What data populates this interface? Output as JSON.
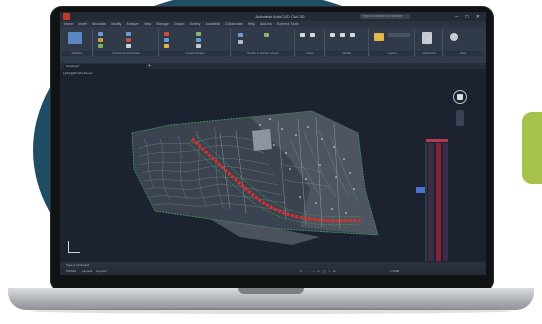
{
  "window": {
    "title": "Autodesk AutoCAD Civil 3D",
    "search_placeholder": "Type a keyword or phrase",
    "controls": "–  □  ✕"
  },
  "menu": {
    "items": [
      "Home",
      "Insert",
      "Annotate",
      "Modify",
      "Analyze",
      "View",
      "Manage",
      "Output",
      "Survey",
      "Autodesk",
      "Collaborate",
      "Help",
      "Add-ins",
      "Express Tools"
    ]
  },
  "ribbon": {
    "groups": [
      "Palettes",
      "Create Ground Data",
      "Create Design",
      "Profile & Section Views",
      "Draw",
      "Modify",
      "Layers",
      "Clipboard",
      "View"
    ]
  },
  "file_tab": {
    "label": "Drawing1*"
  },
  "viewport": {
    "label": "[-][Top][2D Wireframe]"
  },
  "command_line": {
    "text": "Type a command"
  },
  "status": {
    "model": "MODEL",
    "layout1": "Layout1",
    "layout2": "Layout2",
    "tools": "# ::: ⊥ ∠ ◫ ⌖ ⊞",
    "scale": "1:1000"
  },
  "colors": {
    "accent_green": "#a6c24a",
    "blob_blue": "#1f4e64",
    "contour": "#8e96a3",
    "boundary": "#3fa05a",
    "alignment": "#d9302b"
  },
  "icons": [
    "app-logo-icon",
    "navcube-icon",
    "ucs-icon",
    "plus-icon"
  ]
}
